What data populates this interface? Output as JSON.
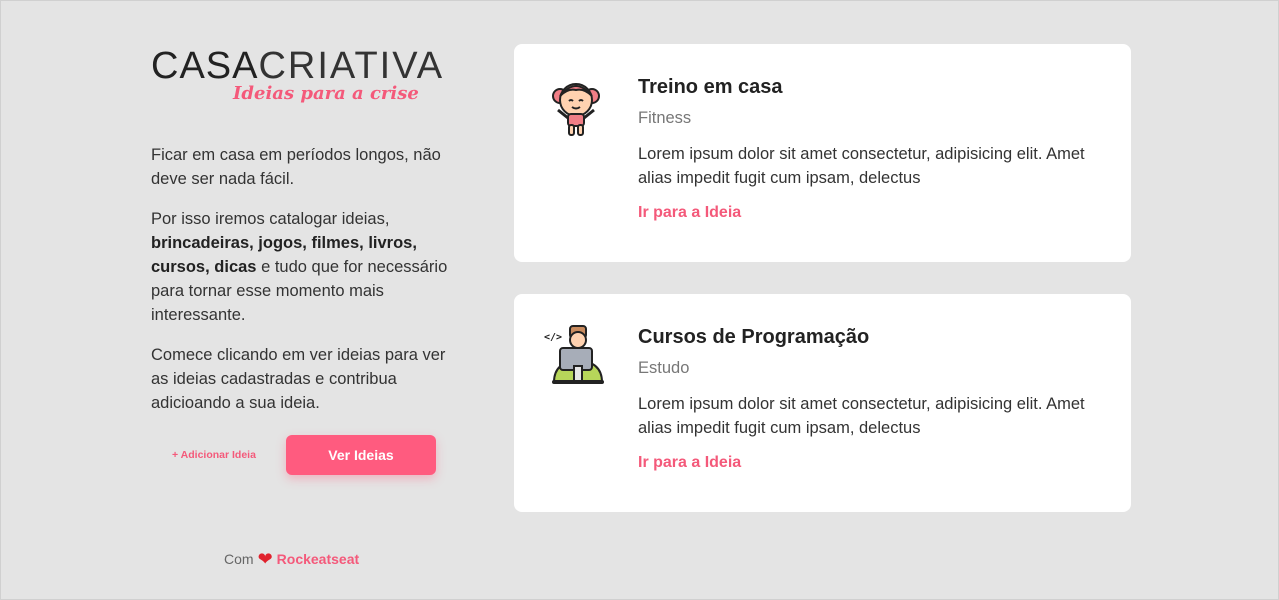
{
  "brand": {
    "logo_bold": "CASA",
    "logo_light": "CRIATIVA",
    "tagline": "Ideias para a crise"
  },
  "intro": {
    "p1": "Ficar em casa em períodos longos, não deve ser nada fácil.",
    "p2_start": "Por isso iremos catalogar ideias, ",
    "p2_bold": "brincadeiras, jogos, filmes, livros, cursos, dicas",
    "p2_end": " e tudo que for necessário para tornar esse momento mais interessante.",
    "p3": "Comece clicando em ver ideias para ver as ideias cadastradas e contribua adicioando a sua ideia."
  },
  "actions": {
    "add_label": "+ Adicionar Ideia",
    "view_label": "Ver Ideias"
  },
  "footer": {
    "prefix": "Com",
    "heart": "❤",
    "brand": "Rockeatseat"
  },
  "cards": [
    {
      "title": "Treino em casa",
      "category": "Fitness",
      "description": "Lorem ipsum dolor sit amet consectetur, adipisicing elit. Amet alias impedit fugit cum ipsam, delectus",
      "link": "Ir para a Ideia",
      "icon": "fitness-girl-icon"
    },
    {
      "title": "Cursos de Programação",
      "category": "Estudo",
      "description": "Lorem ipsum dolor sit amet consectetur, adipisicing elit. Amet alias impedit fugit cum ipsam, delectus",
      "link": "Ir para a Ideia",
      "icon": "programmer-icon"
    }
  ],
  "colors": {
    "accent": "#ff5b7f",
    "background": "#e4e4e4",
    "card": "#ffffff"
  }
}
